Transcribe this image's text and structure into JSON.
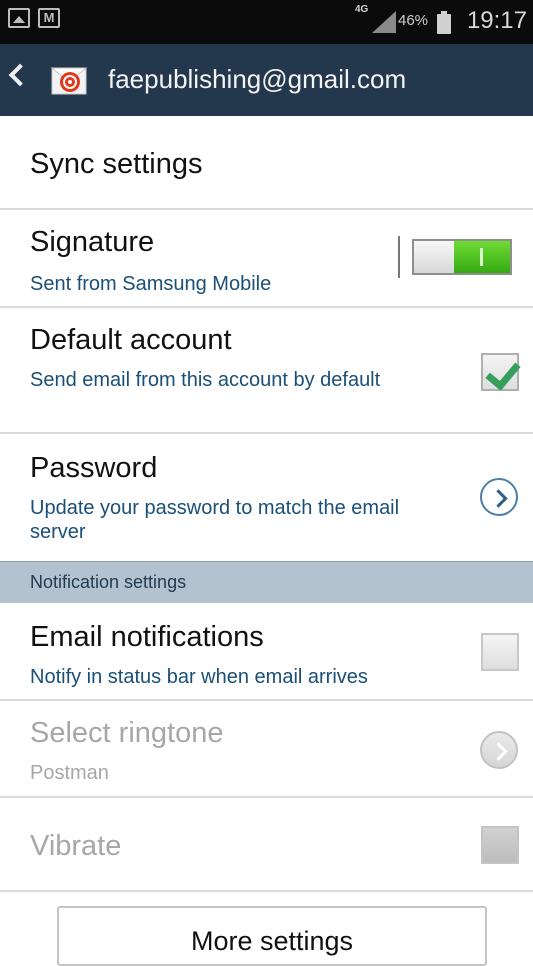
{
  "status_bar": {
    "network": "4G",
    "battery_percent": "46%",
    "time": "19:17",
    "icons": [
      "gallery-notification-icon",
      "gmail-notification-icon",
      "signal-icon",
      "battery-icon"
    ]
  },
  "action_bar": {
    "account": "faepublishing@gmail.com",
    "back_icon": "chevron-left-icon",
    "app_icon": "email-app-icon"
  },
  "settings": {
    "sync": {
      "title": "Sync settings"
    },
    "signature": {
      "title": "Signature",
      "subtitle": "Sent from Samsung Mobile",
      "enabled": true
    },
    "default_account": {
      "title": "Default account",
      "subtitle": "Send email from this account by default",
      "checked": true
    },
    "password": {
      "title": "Password",
      "subtitle": "Update your password to match the email server"
    }
  },
  "notification_section": {
    "header": "Notification settings",
    "email_notifications": {
      "title": "Email notifications",
      "subtitle": "Notify in status bar when email arrives",
      "checked": false
    },
    "ringtone": {
      "title": "Select ringtone",
      "value": "Postman",
      "enabled": false
    },
    "vibrate": {
      "title": "Vibrate",
      "enabled": false
    }
  },
  "more_settings": {
    "label": "More settings"
  },
  "colors": {
    "action_bar": "#23384c",
    "section_header": "#b3c2ce",
    "subtitle": "#1a4f78",
    "toggle_on": "#48c21e",
    "check": "#36a05a"
  }
}
